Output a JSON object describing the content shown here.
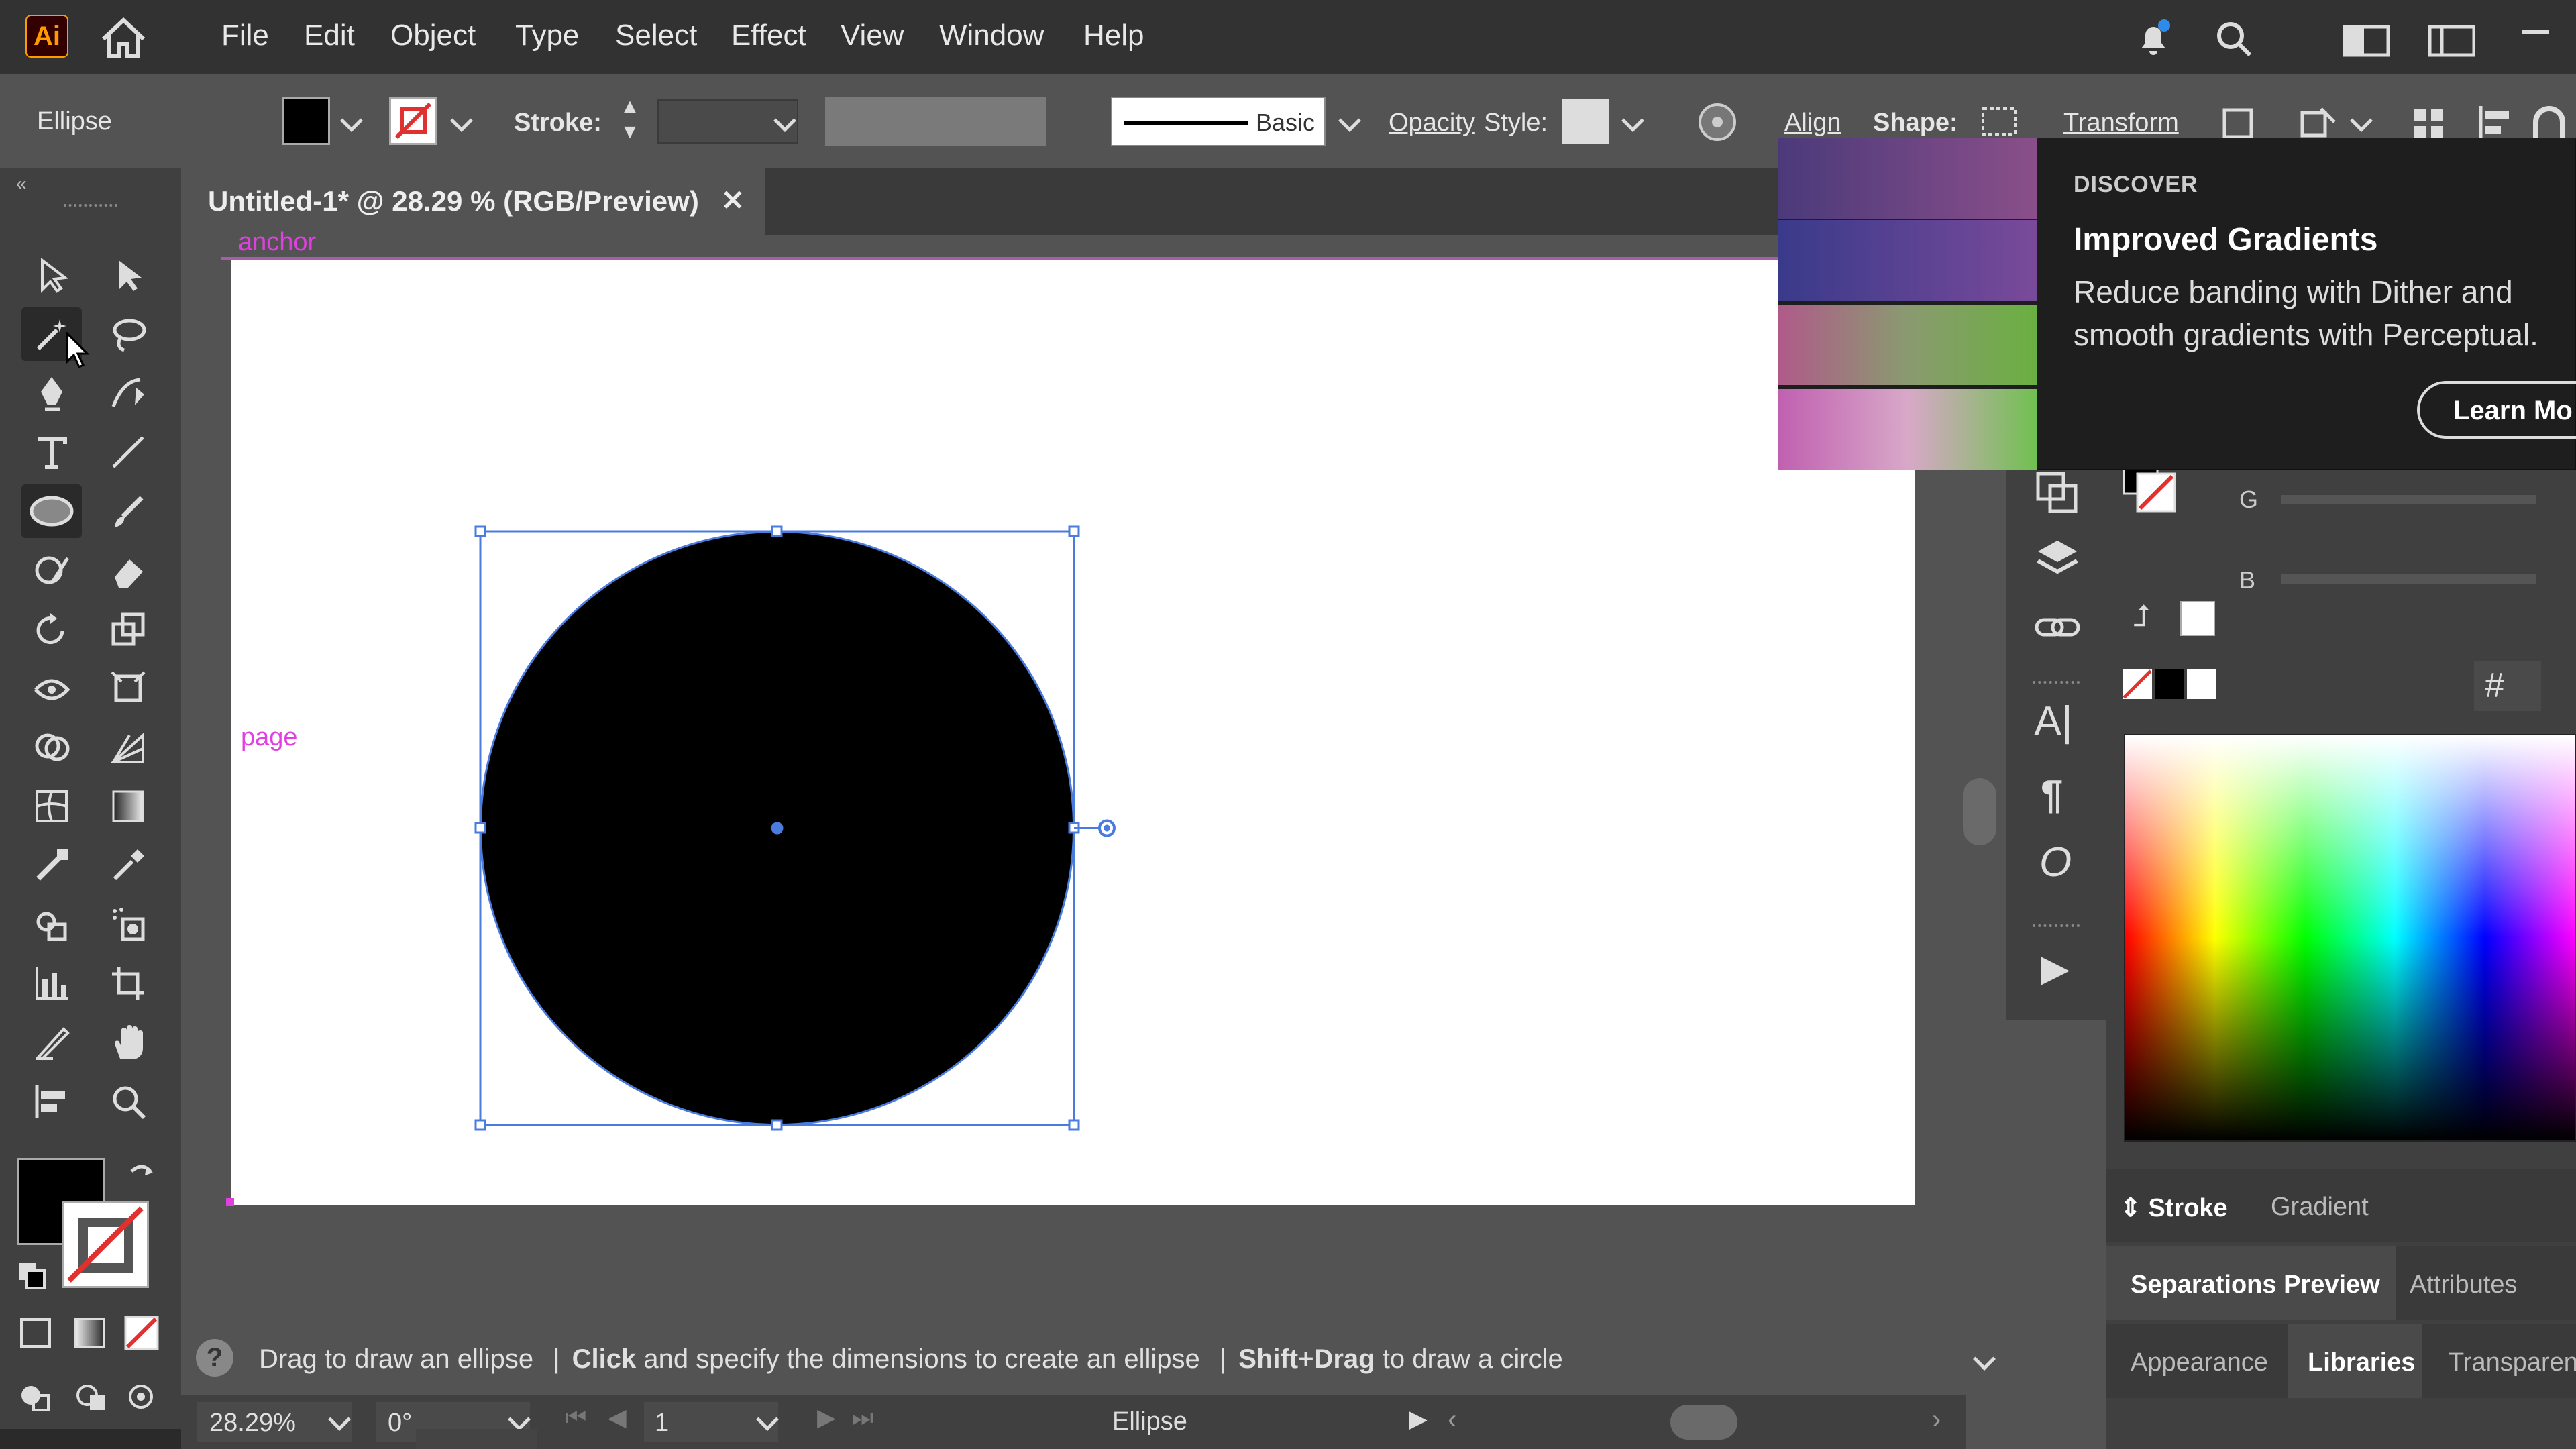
{
  "menubar": {
    "logo": "Ai",
    "items": [
      "File",
      "Edit",
      "Object",
      "Type",
      "Select",
      "Effect",
      "View",
      "Window",
      "Help"
    ]
  },
  "control": {
    "object_label": "Ellipse",
    "stroke_label": "Stroke:",
    "brush_label": "Basic",
    "opacity_label": "Opacity",
    "style_label": "Style:",
    "align_label": "Align",
    "shape_label": "Shape:",
    "transform_label": "Transform"
  },
  "document": {
    "tab_title": "Untitled-1* @ 28.29 % (RGB/Preview)",
    "close_glyph": "✕",
    "smart_guide_top": "anchor",
    "smart_guide_page": "page"
  },
  "discover": {
    "heading": "DISCOVER",
    "title": "Improved Gradients",
    "body_line1": "Reduce banding with Dither and",
    "body_line2": "smooth gradients with Perceptual.",
    "button": "Learn Mo"
  },
  "color_panel": {
    "g_label": "G",
    "b_label": "B",
    "hash_label": "#"
  },
  "panel_tabs": {
    "row1": [
      "Stroke",
      "Gradient"
    ],
    "row2": [
      "Separations Preview",
      "Attributes"
    ],
    "row3": [
      "Appearance",
      "Libraries",
      "Transparen"
    ]
  },
  "status": {
    "hint_part1": "Drag to draw an ellipse",
    "sep1": "|",
    "hint_part2_bold": "Click",
    "hint_part2_rest": " and specify the dimensions to create an ellipse",
    "sep2": "|",
    "hint_part3_bold": "Shift+Drag",
    "hint_part3_rest": " to draw a circle",
    "help_glyph": "?"
  },
  "bottom": {
    "zoom": "28.29%",
    "rotation": "0°",
    "artboard_num": "1",
    "current_tool": "Ellipse"
  },
  "colors": {
    "accent_select": "#4a7bde",
    "smart_guide": "#e040e0"
  },
  "icons": {
    "home": "home-icon",
    "bell": "bell-icon",
    "search": "search-icon",
    "arrange": "arrange-documents-icon",
    "workspace": "workspace-icon"
  }
}
